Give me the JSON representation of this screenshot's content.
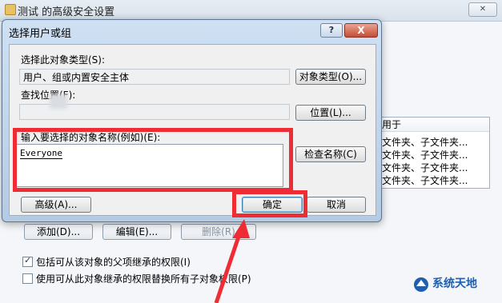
{
  "background_window": {
    "title": "测试 的高级安全设置",
    "list_header": "用于",
    "list_rows": [
      "文件夹、子文件夹...",
      "文件夹、子文件夹...",
      "文件夹、子文件夹...",
      "文件夹、子文件夹..."
    ],
    "add_label": "添加(D)...",
    "edit_label": "编辑(E)...",
    "remove_label": "删除(R)",
    "checkbox_inherit": "包括可从该对象的父项继承的权限(I)",
    "checkbox_replace": "使用可从此对象继承的权限替换所有子对象权限(P)"
  },
  "dialog": {
    "title": "选择用户或组",
    "help_label": "?",
    "close_label": "X",
    "object_type_label": "选择此对象类型(S):",
    "object_type_value": "用户、组或内置安全主体",
    "object_type_button": "对象类型(O)...",
    "location_label": "查找位置(F):",
    "location_value": "",
    "location_button": "位置(L)...",
    "enter_name_label": "输入要选择的对象名称(例如)(E):",
    "enter_name_value": "Everyone",
    "check_names_button": "检查名称(C)",
    "advanced_button": "高级(A)...",
    "ok_button": "确定",
    "cancel_button": "取消"
  },
  "watermark": {
    "text": "系统天地"
  },
  "colors": {
    "annotation_red": "#ef2b33",
    "dialog_frame": "#b5cbe3"
  }
}
